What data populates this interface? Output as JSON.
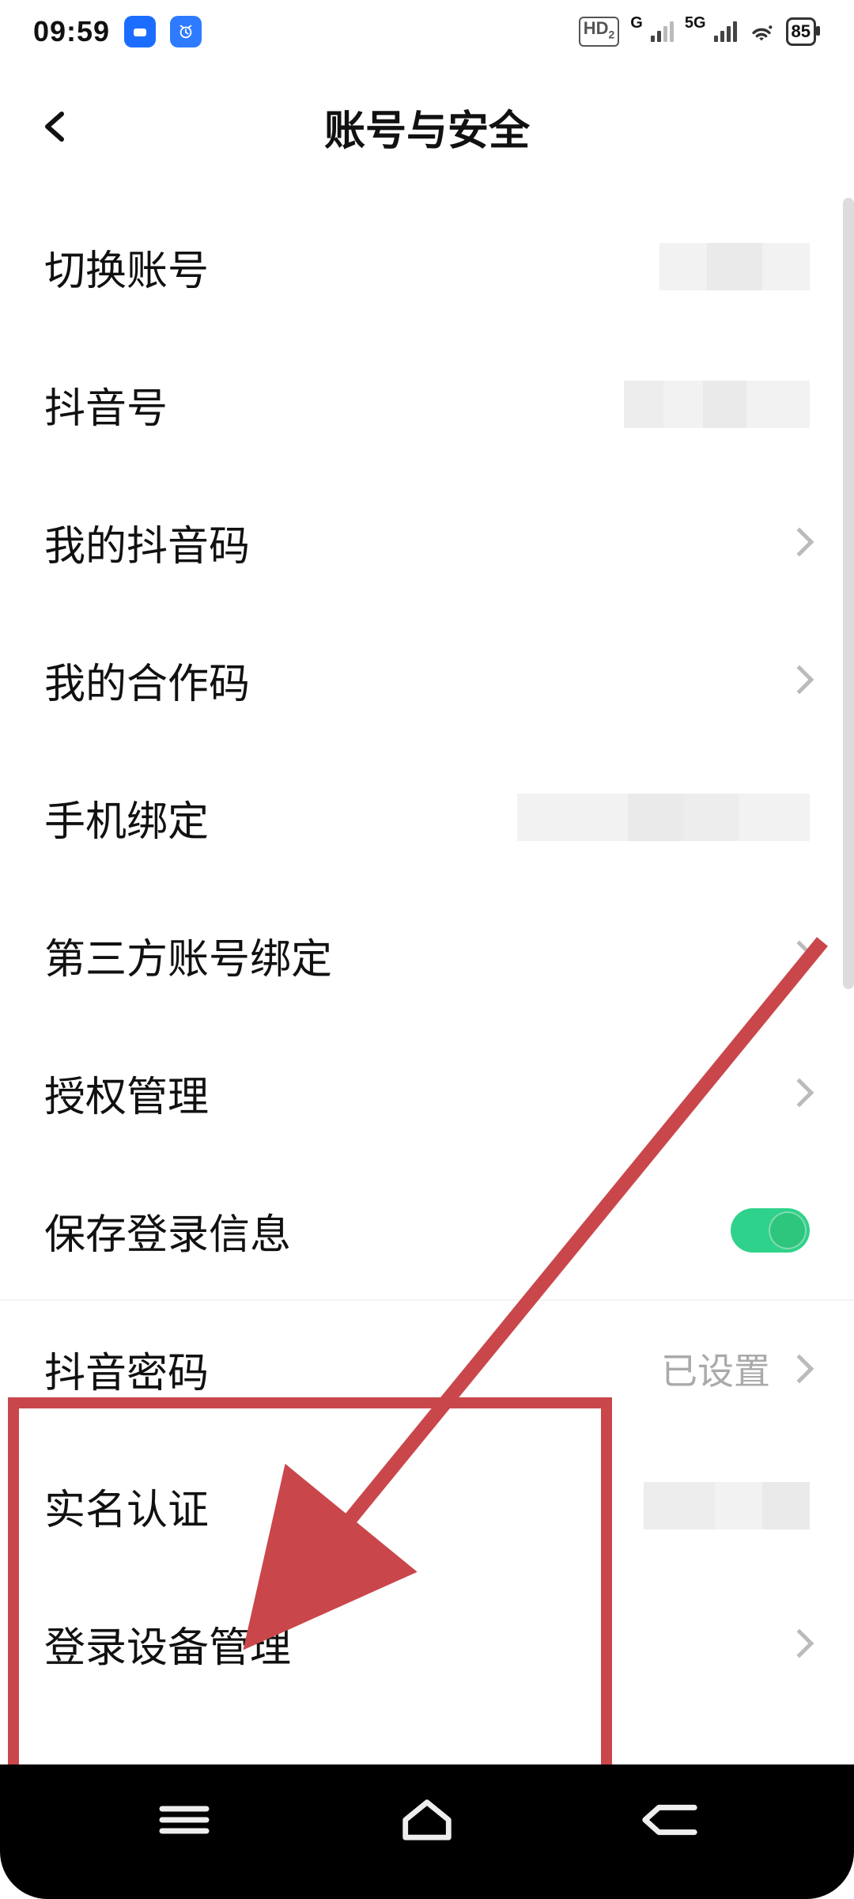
{
  "statusbar": {
    "time": "09:59",
    "hd_label": "HD",
    "hd_sub": "2",
    "net1_label": "G",
    "net2_label": "5G",
    "battery": "85"
  },
  "header": {
    "title": "账号与安全"
  },
  "rows": {
    "switch_account": {
      "label": "切换账号"
    },
    "douyin_id": {
      "label": "抖音号"
    },
    "my_code": {
      "label": "我的抖音码"
    },
    "coop_code": {
      "label": "我的合作码"
    },
    "phone_bind": {
      "label": "手机绑定"
    },
    "third_party": {
      "label": "第三方账号绑定"
    },
    "auth_mgmt": {
      "label": "授权管理"
    },
    "save_login": {
      "label": "保存登录信息",
      "on": true
    },
    "password": {
      "label": "抖音密码",
      "value": "已设置"
    },
    "realname": {
      "label": "实名认证"
    },
    "device_mgmt": {
      "label": "登录设备管理"
    }
  }
}
